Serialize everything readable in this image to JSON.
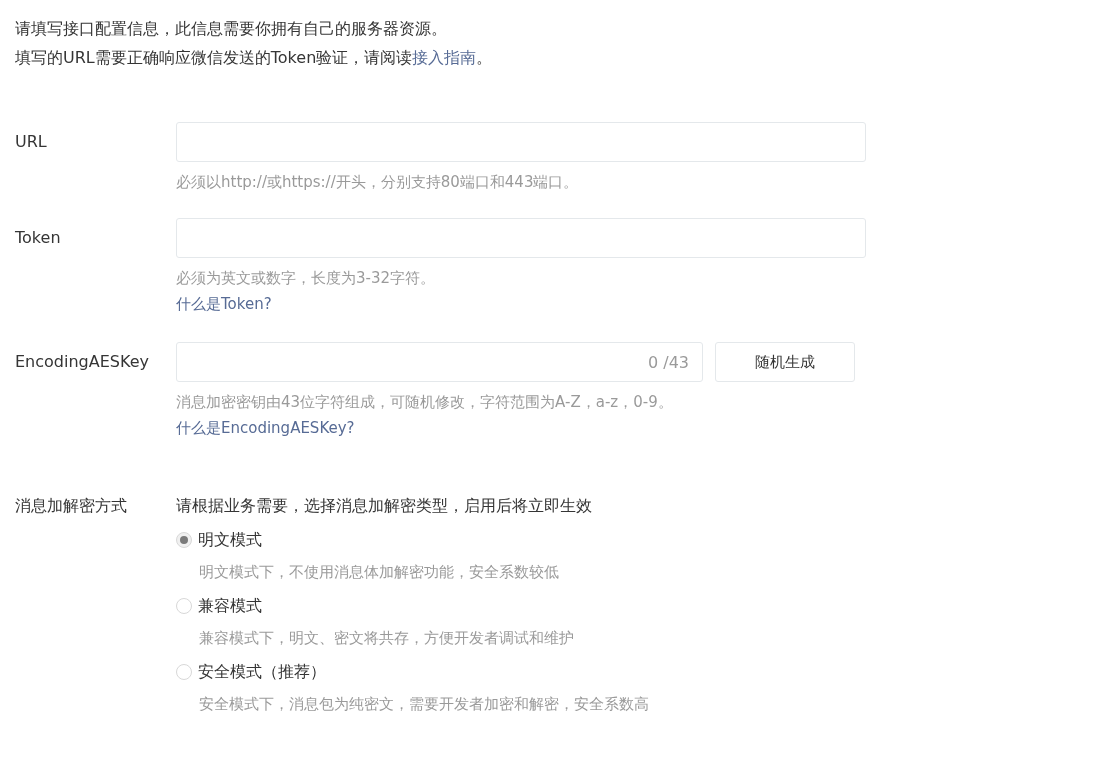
{
  "intro": {
    "line_1": "请填写接口配置信息，此信息需要你拥有自己的服务器资源。",
    "line_2_before": "填写的URL需要正确响应微信发送的Token验证，请阅读",
    "line_2_link": "接入指南",
    "line_2_after": "。"
  },
  "fields": [
    {
      "kind": "text",
      "label": "URL",
      "hint": "必须以http://或https://开头，分别支持80端口和443端口。"
    },
    {
      "kind": "text",
      "label": "Token",
      "hint": "必须为英文或数字，长度为3-32字符。",
      "help_link": "什么是Token?"
    },
    {
      "kind": "counter",
      "label": "EncodingAESKey",
      "counter": "0 /43",
      "button": "随机生成",
      "hint": "消息加密密钥由43位字符组成，可随机修改，字符范围为A-Z，a-z，0-9。",
      "help_link": "什么是EncodingAESKey?"
    }
  ],
  "encryption": {
    "label": "消息加解密方式",
    "description": "请根据业务需要，选择消息加解密类型，启用后将立即生效",
    "options": [
      {
        "label": "明文模式",
        "hint": "明文模式下，不使用消息体加解密功能，安全系数较低",
        "selected": true
      },
      {
        "label": "兼容模式",
        "hint": "兼容模式下，明文、密文将共存，方便开发者调试和维护",
        "selected": false
      },
      {
        "label": "安全模式（推荐）",
        "hint": "安全模式下，消息包为纯密文，需要开发者加密和解密，安全系数高",
        "selected": false
      }
    ]
  }
}
